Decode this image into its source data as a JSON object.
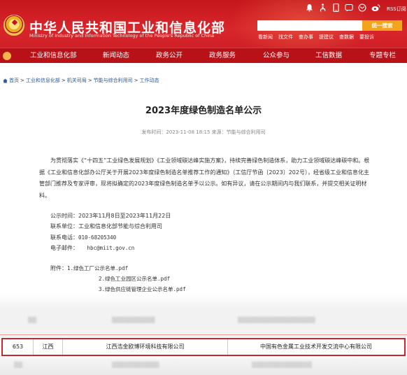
{
  "header": {
    "title_cn": "中华人民共和国工业和信息化部",
    "title_en": "Ministry of Industry and Information Technology of the People's Republic of China",
    "rss_label": "RSS订阅",
    "search_button": "统一搜索",
    "quick_links": [
      "看新闻",
      "找文件",
      "查办事",
      "提建议",
      "查数据",
      "要投诉"
    ]
  },
  "nav": {
    "items": [
      "工业和信息化部",
      "新闻动态",
      "政务公开",
      "政务服务",
      "公众参与",
      "工信数据",
      "专题专栏"
    ]
  },
  "breadcrumb": {
    "items": [
      "首页",
      "工业和信息化部",
      "机关司局",
      "节能与综合利用司",
      "工作动态"
    ],
    "separator": ">"
  },
  "article": {
    "title": "2023年度绿色制造名单公示",
    "meta": "发布时间：2023-11-08 18:15   来源：节能与综合利用司",
    "paragraph": "为贯彻落实《“十四五”工业绿色发展规划》《工业领域碳达峰实施方案》，持续完善绿色制造体系，助力工业领域碳达峰碳中和。根据《工业和信息化部办公厅关于开展2023年度绿色制造名单推荐工作的通知》（工信厅节函〔2023〕202号），经省级工业和信息化主管部门推荐及专家评审，现将拟确定的2023年度绿色制造名单予以公示。如有异议，请在公示期间内与我们联系，并提交相关证明材料。",
    "notice_period": "公示时间：2023年11月8日至2023年11月22日",
    "contact_unit": "联系单位：工业和信息化部节能与综合利用司",
    "phone_label": "联系电话：",
    "phone": "010-68205340",
    "email_label": "电子邮件：",
    "email": "hbc@miit.gov.cn",
    "attachments_label": "附件：",
    "attachments": [
      "1.绿色工厂公示名单.pdf",
      "2.绿色工业园区公示名单.pdf",
      "3.绿色供应链管理企业公示名单.pdf"
    ]
  },
  "highlighted_row": {
    "index": "653",
    "province": "江西",
    "company": "江西浩金欧博环境科技有限公司",
    "third_party": "中国有色金属工业技术开发交流中心有限公司"
  },
  "colors": {
    "brand_red": "#c4161c",
    "nav_red": "#b81218",
    "search_orange": "#f4a31d",
    "link_blue": "#2a5a9c",
    "highlight_border": "#c8272d"
  }
}
